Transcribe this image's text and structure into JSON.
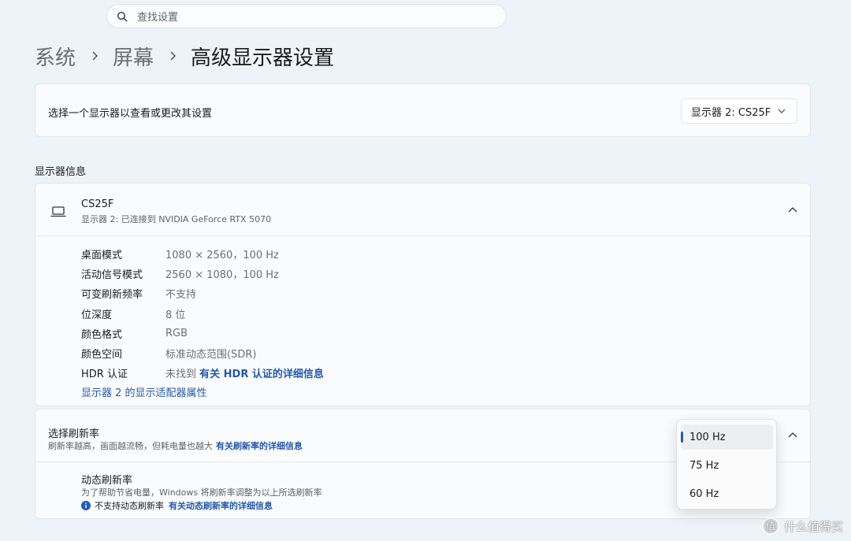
{
  "search": {
    "placeholder": "查找设置",
    "icon": "search-icon"
  },
  "breadcrumb": {
    "items": [
      "系统",
      "屏幕"
    ],
    "current": "高级显示器设置"
  },
  "display_select": {
    "label": "选择一个显示器以查看或更改其设置",
    "value": "显示器 2: CS25F"
  },
  "section_title": "显示器信息",
  "monitor": {
    "name": "CS25F",
    "subtitle": "显示器 2: 已连接到 NVIDIA GeForce RTX 5070",
    "rows": [
      {
        "key": "桌面模式",
        "value": "1080 × 2560，100 Hz"
      },
      {
        "key": "活动信号模式",
        "value": "2560 × 1080，100 Hz"
      },
      {
        "key": "可变刷新频率",
        "value": "不支持"
      },
      {
        "key": "位深度",
        "value": "8 位"
      },
      {
        "key": "颜色格式",
        "value": "RGB"
      },
      {
        "key": "颜色空间",
        "value": "标准动态范围(SDR)"
      }
    ],
    "hdr": {
      "key": "HDR 认证",
      "value": "未找到",
      "link": "有关 HDR 认证的详细信息"
    },
    "adapter_link": "显示器 2 的显示适配器属性"
  },
  "refresh": {
    "title": "选择刷新率",
    "desc": "刷新率越高，画面越流畅，但耗电量也越大",
    "desc_link": "有关刷新率的详细信息",
    "options": [
      "100 Hz",
      "75 Hz",
      "60 Hz"
    ],
    "selected": "100 Hz",
    "dynamic": {
      "title": "动态刷新率",
      "desc": "为了帮助节省电量，Windows 将刷新率调整为以上所选刷新率",
      "note": "不支持动态刷新率",
      "note_link": "有关动态刷新率的详细信息"
    }
  },
  "watermark": "什么值得买",
  "colors": {
    "accent": "#1f5fb4",
    "link": "#2659a8",
    "background": "#eef3f8"
  }
}
